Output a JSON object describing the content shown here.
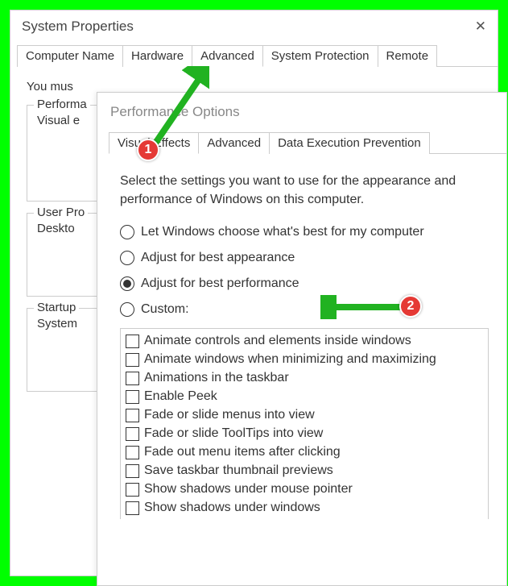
{
  "window1": {
    "title": "System Properties",
    "tabs": [
      "Computer Name",
      "Hardware",
      "Advanced",
      "System Protection",
      "Remote"
    ],
    "active_tab_index": 2,
    "note": "You mus",
    "groups": {
      "perf": {
        "label": "Performa",
        "text": "Visual e"
      },
      "user": {
        "label": "User Pro",
        "text": "Deskto"
      },
      "startup": {
        "label": "Startup",
        "text": "System"
      }
    }
  },
  "window2": {
    "title": "Performance Options",
    "tabs": [
      "Visual Effects",
      "Advanced",
      "Data Execution Prevention"
    ],
    "active_tab_index": 0,
    "desc": "Select the settings you want to use for the appearance and performance of Windows on this computer.",
    "radios": [
      "Let Windows choose what's best for my computer",
      "Adjust for best appearance",
      "Adjust for best performance",
      "Custom:"
    ],
    "selected_radio_index": 2,
    "checks": [
      "Animate controls and elements inside windows",
      "Animate windows when minimizing and maximizing",
      "Animations in the taskbar",
      "Enable Peek",
      "Fade or slide menus into view",
      "Fade or slide ToolTips into view",
      "Fade out menu items after clicking",
      "Save taskbar thumbnail previews",
      "Show shadows under mouse pointer",
      "Show shadows under windows"
    ]
  },
  "annotations": {
    "b1": "1",
    "b2": "2"
  }
}
